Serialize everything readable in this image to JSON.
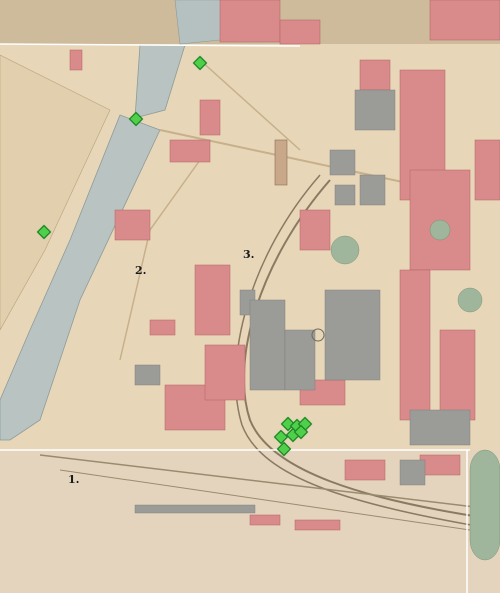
{
  "map": {
    "area_labels": [
      "1.",
      "2.",
      "3."
    ],
    "colors": {
      "paper": "#e7d6b8",
      "paper_dark": "#d9c4a0",
      "water": "#b8c3c0",
      "buildings": "#d98a8a",
      "buildings_dark": "#c46c6c",
      "grey_blocks": "#9a9a9a",
      "marker": "#4fd04a"
    },
    "markers_count": 10
  }
}
